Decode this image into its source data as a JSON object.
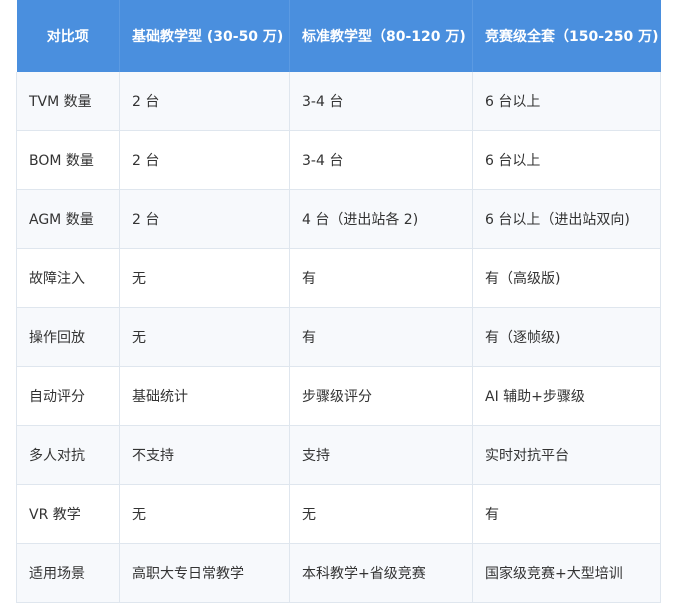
{
  "table": {
    "headers": [
      "对比项",
      "基础教学型 (30-50 万)",
      "标准教学型（80-120 万)",
      "竞赛级全套（150-250 万)"
    ],
    "rows": [
      [
        "TVM 数量",
        "2 台",
        "3-4 台",
        "6 台以上"
      ],
      [
        "BOM 数量",
        "2 台",
        "3-4 台",
        "6 台以上"
      ],
      [
        "AGM 数量",
        "2 台",
        "4 台（进出站各 2)",
        "6 台以上（进出站双向)"
      ],
      [
        "故障注入",
        "无",
        "有",
        "有（高级版)"
      ],
      [
        "操作回放",
        "无",
        "有",
        "有（逐帧级)"
      ],
      [
        "自动评分",
        "基础统计",
        "步骤级评分",
        "AI 辅助+步骤级"
      ],
      [
        "多人对抗",
        "不支持",
        "支持",
        "实时对抗平台"
      ],
      [
        "VR 教学",
        "无",
        "无",
        "有"
      ],
      [
        "适用场景",
        "高职大专日常教学",
        "本科教学+省级竞赛",
        "国家级竞赛+大型培训"
      ]
    ]
  }
}
